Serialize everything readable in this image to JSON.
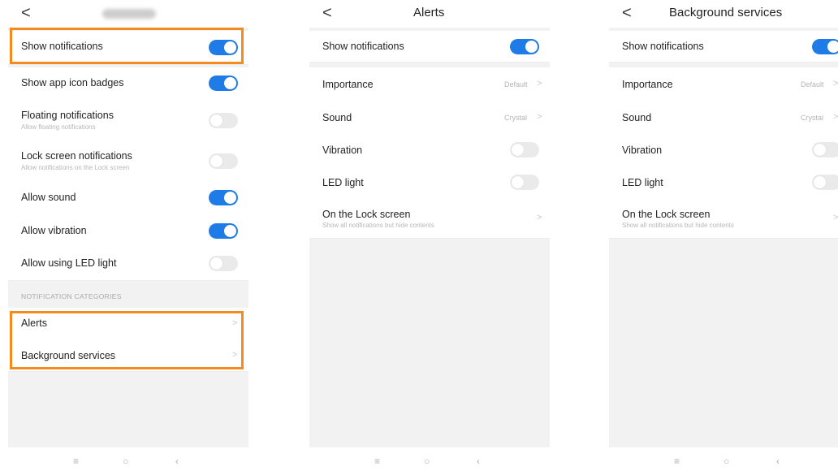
{
  "colors": {
    "accent": "#1f7ce6",
    "highlight": "#f58a1f",
    "background": "#f2f2f2"
  },
  "icons": {
    "back": "chevron-left-icon",
    "forward": "chevron-right-icon",
    "menu": "menu-icon",
    "home": "home-icon",
    "nav_back": "back-icon"
  },
  "nav_glyphs": {
    "back": "<",
    "forward": ">",
    "menu": "≡",
    "home": "○",
    "nav_back": "‹"
  },
  "screen1": {
    "title": "",
    "rows": [
      {
        "label": "Show notifications",
        "toggle": "on"
      },
      {
        "label": "Show app icon badges",
        "toggle": "on"
      },
      {
        "label": "Floating notifications",
        "sub": "Allow floating notifications",
        "toggle": "off"
      },
      {
        "label": "Lock screen notifications",
        "sub": "Allow notifications on the Lock screen",
        "toggle": "off"
      },
      {
        "label": "Allow sound",
        "toggle": "on"
      },
      {
        "label": "Allow vibration",
        "toggle": "on"
      },
      {
        "label": "Allow using LED light",
        "toggle": "off"
      }
    ],
    "section_header": "NOTIFICATION CATEGORIES",
    "categories": [
      {
        "label": "Alerts"
      },
      {
        "label": "Background services"
      }
    ]
  },
  "screen2": {
    "title": "Alerts",
    "show_notifications": {
      "label": "Show notifications",
      "toggle": "on"
    },
    "importance": {
      "label": "Importance",
      "value": "Default"
    },
    "sound": {
      "label": "Sound",
      "value": "Crystal"
    },
    "vibration": {
      "label": "Vibration",
      "toggle": "off"
    },
    "led": {
      "label": "LED light",
      "toggle": "off"
    },
    "lock": {
      "label": "On the Lock screen",
      "sub": "Show all notifications but hide contents"
    }
  },
  "screen3": {
    "title": "Background services",
    "show_notifications": {
      "label": "Show notifications",
      "toggle": "on"
    },
    "importance": {
      "label": "Importance",
      "value": "Default"
    },
    "sound": {
      "label": "Sound",
      "value": "Crystal"
    },
    "vibration": {
      "label": "Vibration",
      "toggle": "off"
    },
    "led": {
      "label": "LED light",
      "toggle": "off"
    },
    "lock": {
      "label": "On the Lock screen",
      "sub": "Show all notifications but hide contents"
    }
  }
}
